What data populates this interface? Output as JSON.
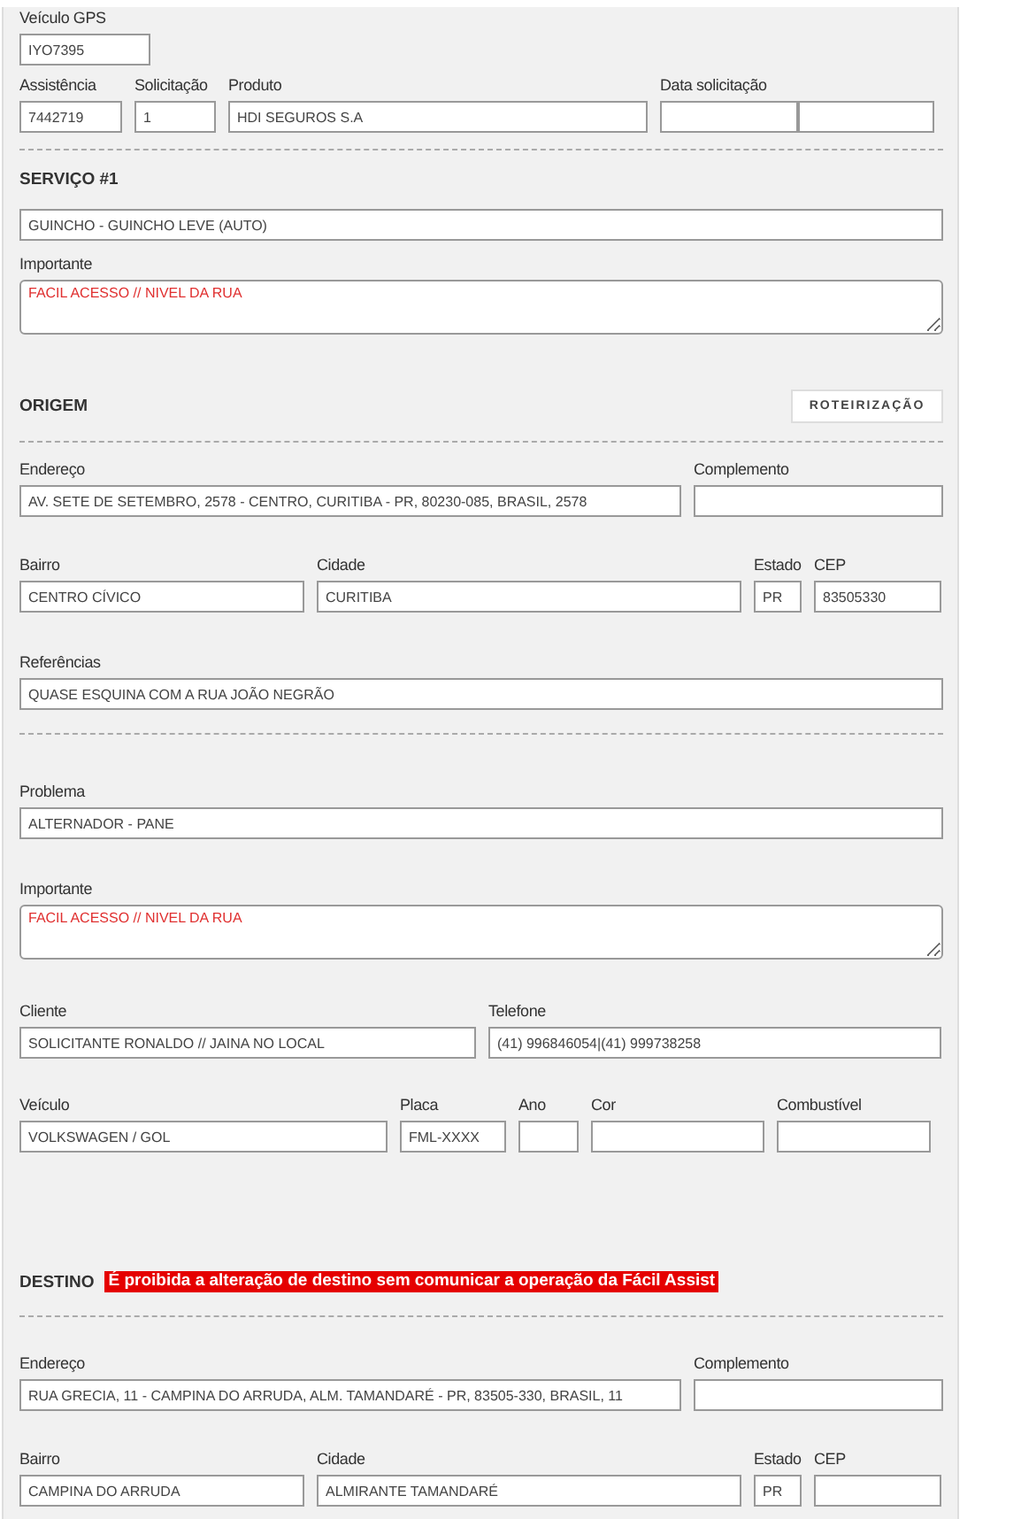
{
  "form": {
    "blocks": [
      {
        "kind": "fields",
        "fields": [
          {
            "label": "Veículo GPS",
            "value": "IYO7395"
          }
        ]
      },
      {
        "kind": "fields",
        "fields": [
          {
            "label": "Assistência",
            "value": "7442719"
          },
          {
            "label": "Solicitação",
            "value": "1"
          },
          {
            "label": "Produto",
            "value": "HDI SEGUROS S.A"
          },
          {
            "label": "Data solicitação",
            "kind": "date_time"
          }
        ]
      },
      {
        "kind": "divider"
      },
      {
        "kind": "heading",
        "title": "SERVIÇO #1"
      },
      {
        "kind": "fields",
        "fields": [
          {
            "value": "GUINCHO - GUINCHO LEVE (AUTO)"
          }
        ]
      },
      {
        "kind": "textarea",
        "label": "Importante",
        "value": "FACIL ACESSO // NIVEL DA RUA"
      },
      {
        "kind": "heading",
        "title": "ORIGEM",
        "button": "ROTEIRIZAÇÃO"
      },
      {
        "kind": "divider"
      },
      {
        "kind": "fields",
        "fields": [
          {
            "label": "Endereço",
            "value": "AV. SETE DE SETEMBRO, 2578 - CENTRO, CURITIBA - PR, 80230-085, BRASIL, 2578"
          },
          {
            "label": "Complemento"
          }
        ]
      },
      {
        "kind": "fields",
        "fields": [
          {
            "label": "Bairro",
            "value": "CENTRO CÍVICO"
          },
          {
            "label": "Cidade",
            "value": "CURITIBA"
          },
          {
            "label": "Estado",
            "value": "PR"
          },
          {
            "label": "CEP",
            "value": "83505330"
          }
        ]
      },
      {
        "kind": "fields",
        "fields": [
          {
            "label": "Referências",
            "value": "QUASE ESQUINA COM A RUA JOÃO NEGRÃO"
          }
        ]
      },
      {
        "kind": "divider"
      },
      {
        "kind": "fields",
        "fields": [
          {
            "label": "Problema",
            "value": "ALTERNADOR - PANE"
          }
        ]
      },
      {
        "kind": "textarea",
        "label": "Importante",
        "value": "FACIL ACESSO // NIVEL DA RUA"
      },
      {
        "kind": "fields",
        "fields": [
          {
            "label": "Cliente",
            "value": "SOLICITANTE RONALDO // JAINA NO LOCAL"
          },
          {
            "label": "Telefone",
            "value": "(41) 996846054|(41) 999738258"
          }
        ]
      },
      {
        "kind": "fields",
        "fields": [
          {
            "label": "Veículo",
            "value": "VOLKSWAGEN / GOL"
          },
          {
            "label": "Placa",
            "value": "FML-XXXX"
          },
          {
            "label": "Ano"
          },
          {
            "label": "Cor"
          },
          {
            "label": "Combustível"
          }
        ]
      },
      {
        "kind": "heading",
        "title": "DESTINO",
        "alert": "É proibida a alteração de destino sem comunicar a operação da Fácil Assist"
      },
      {
        "kind": "divider"
      },
      {
        "kind": "fields",
        "fields": [
          {
            "label": "Endereço",
            "value": "RUA GRECIA, 11 - CAMPINA DO ARRUDA, ALM. TAMANDARÉ - PR, 83505-330, BRASIL, 11"
          },
          {
            "label": "Complemento"
          }
        ]
      },
      {
        "kind": "fields",
        "fields": [
          {
            "label": "Bairro",
            "value": "CAMPINA DO ARRUDA"
          },
          {
            "label": "Cidade",
            "value": "ALMIRANTE TAMANDARÉ"
          },
          {
            "label": "Estado",
            "value": "PR"
          },
          {
            "label": "CEP"
          }
        ]
      }
    ]
  }
}
